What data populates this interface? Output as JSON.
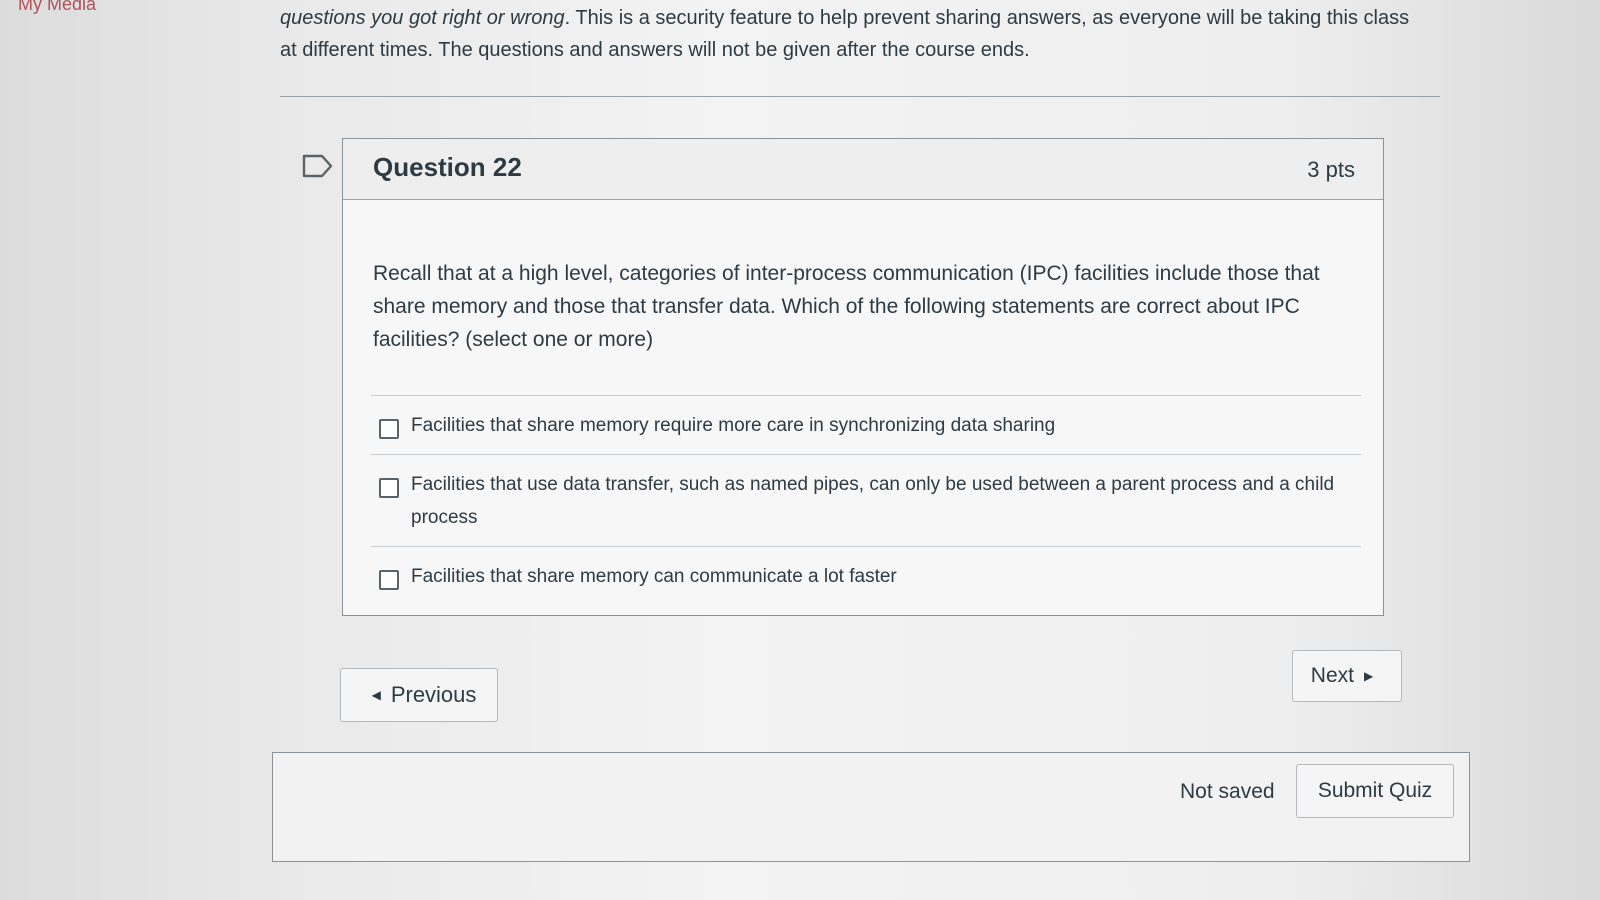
{
  "nav": {
    "my_media": "My Media"
  },
  "notice": {
    "emphasis": "questions you got right or wrong",
    "text_after": ". This is a security feature to help prevent sharing answers, as everyone will be taking this class at different times. The questions and answers will not be given after the course ends."
  },
  "question": {
    "title": "Question 22",
    "points": "3 pts",
    "text": "Recall that at a high level, categories of inter-process communication (IPC) facilities include those that share memory and those that transfer data. Which of the following statements are correct about IPC facilities? (select one or more)",
    "answers": [
      {
        "label": "Facilities that share memory require more care in synchronizing data sharing",
        "checked": false
      },
      {
        "label": "Facilities that use data transfer, such as named pipes, can only be used between a parent process and a child process",
        "checked": false
      },
      {
        "label": "Facilities that share memory can communicate a lot faster",
        "checked": false
      }
    ]
  },
  "navigation": {
    "previous_label": "Previous",
    "next_label": "Next"
  },
  "footer": {
    "status": "Not saved",
    "submit_label": "Submit Quiz"
  },
  "icons": {
    "flag": "flag-icon",
    "prev": "caret-left-icon",
    "next": "caret-right-icon"
  }
}
